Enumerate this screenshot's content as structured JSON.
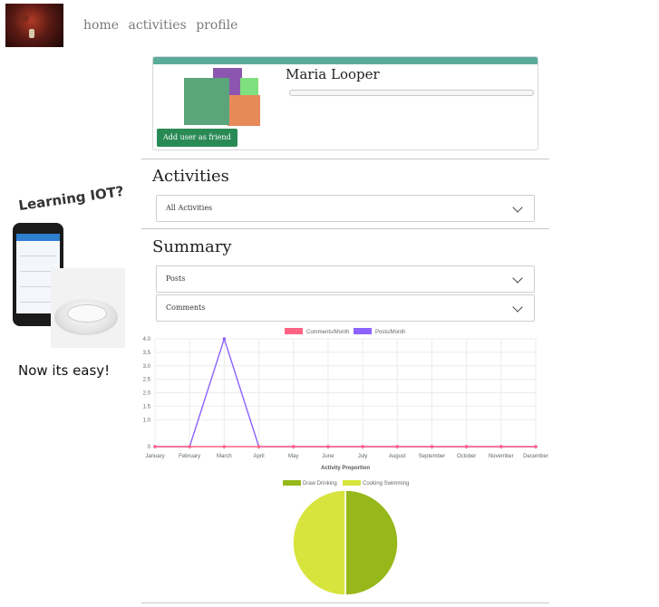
{
  "nav": {
    "items": [
      "home",
      "activities",
      "profile"
    ]
  },
  "ad": {
    "headline": "Learning IOT?",
    "footer": "Now its easy!"
  },
  "profile": {
    "name": "Maria Looper",
    "progress": 0,
    "add_friend_label": "Add user as friend",
    "accent_color": "#5bab9a"
  },
  "activities": {
    "title": "Activities",
    "filter": {
      "selected": "All Activities"
    }
  },
  "summary": {
    "title": "Summary",
    "posts_select": "Posts",
    "comments_select": "Comments"
  },
  "chart_data": [
    {
      "type": "line",
      "categories": [
        "January",
        "February",
        "March",
        "April",
        "May",
        "June",
        "July",
        "August",
        "September",
        "October",
        "November",
        "December"
      ],
      "series": [
        {
          "name": "Comments/Month",
          "color": "#ff6384",
          "values": [
            0,
            0,
            0,
            0,
            0,
            0,
            0,
            0,
            0,
            0,
            0,
            0
          ]
        },
        {
          "name": "Posts/Month",
          "color": "#8c63ff",
          "values": [
            0,
            0,
            4,
            0,
            0,
            0,
            0,
            0,
            0,
            0,
            0,
            0
          ]
        }
      ],
      "yticks": [
        "0",
        "1.0",
        "1.5",
        "2.0",
        "2.5",
        "3.0",
        "3.5",
        "4.0"
      ],
      "ylim": [
        0,
        4
      ],
      "legend": "top",
      "grid": true
    },
    {
      "type": "pie",
      "title": "Activity Proportion",
      "labels": [
        "Draw Drinking",
        "Cooking Swimming"
      ],
      "values": [
        50,
        50
      ],
      "colors": [
        "#97b81a",
        "#d8e43e"
      ],
      "legend": "top"
    }
  ]
}
